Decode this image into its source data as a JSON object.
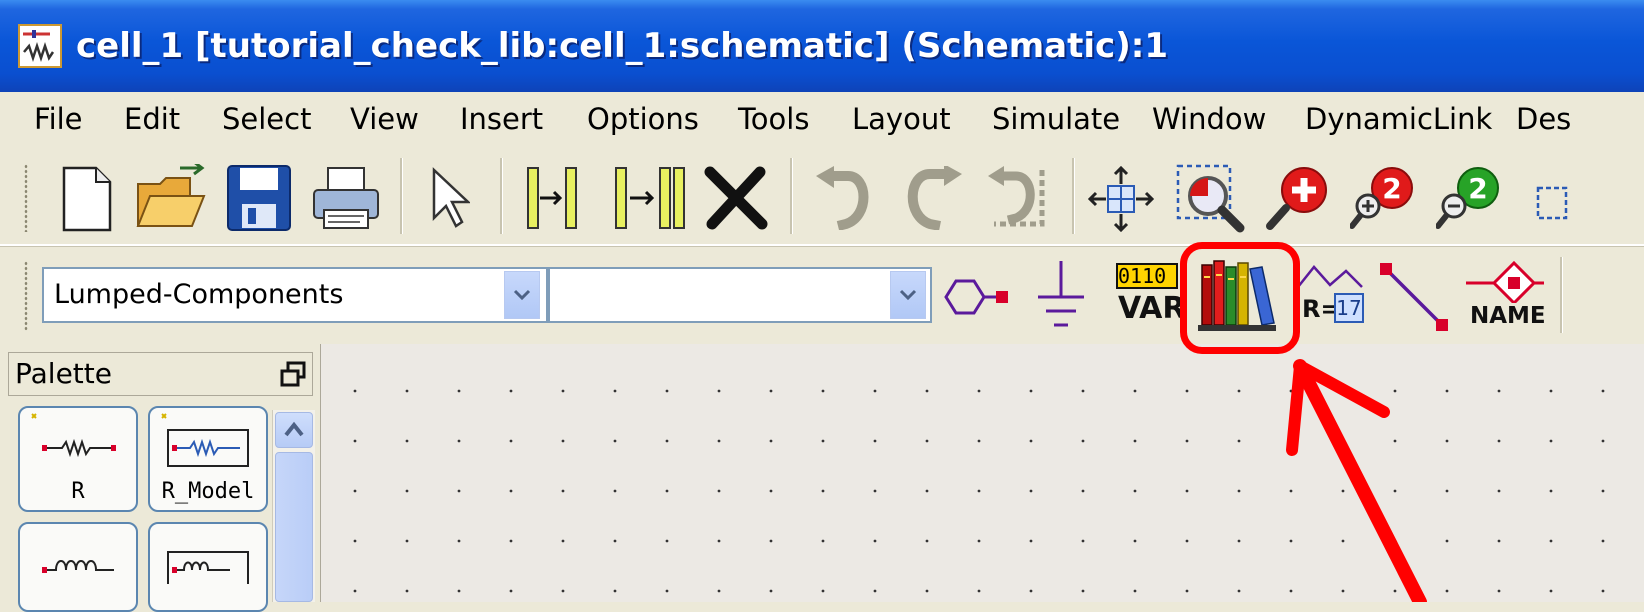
{
  "window": {
    "title": "cell_1 [tutorial_check_lib:cell_1:schematic] (Schematic):1",
    "icon": "schematic-app-icon"
  },
  "menu": [
    "File",
    "Edit",
    "Select",
    "View",
    "Insert",
    "Options",
    "Tools",
    "Layout",
    "Simulate",
    "Window",
    "DynamicLink",
    "Des"
  ],
  "toolbar_main": [
    "new-file-icon",
    "open-folder-icon",
    "save-disk-icon",
    "print-icon",
    "select-arrow-icon",
    "insert-pin-icon",
    "insert-multi-pin-icon",
    "delete-x-icon",
    "undo-icon",
    "redo-icon",
    "undo-all-icon",
    "move-icon",
    "zoom-area-icon",
    "zoom-in-icon",
    "zoom-in-2-icon",
    "zoom-out-2-icon"
  ],
  "toolbar_insert": {
    "library_dropdown": "Lumped-Components",
    "component_dropdown": "",
    "var_label": "VAR",
    "var_digits": "0110",
    "eqn_label": "R=",
    "eqn_value": "17",
    "name_label": "NAME",
    "icons": [
      "port-icon",
      "ground-icon",
      "var-eqn-icon",
      "component-library-icon",
      "equation-icon",
      "wire-icon",
      "name-icon"
    ]
  },
  "palette": {
    "title": "Palette",
    "items": [
      {
        "label": "R"
      },
      {
        "label": "R_Model"
      },
      {
        "label": ""
      },
      {
        "label": ""
      }
    ]
  },
  "annotation": {
    "color": "#ff0000",
    "target": "component-library-icon"
  }
}
